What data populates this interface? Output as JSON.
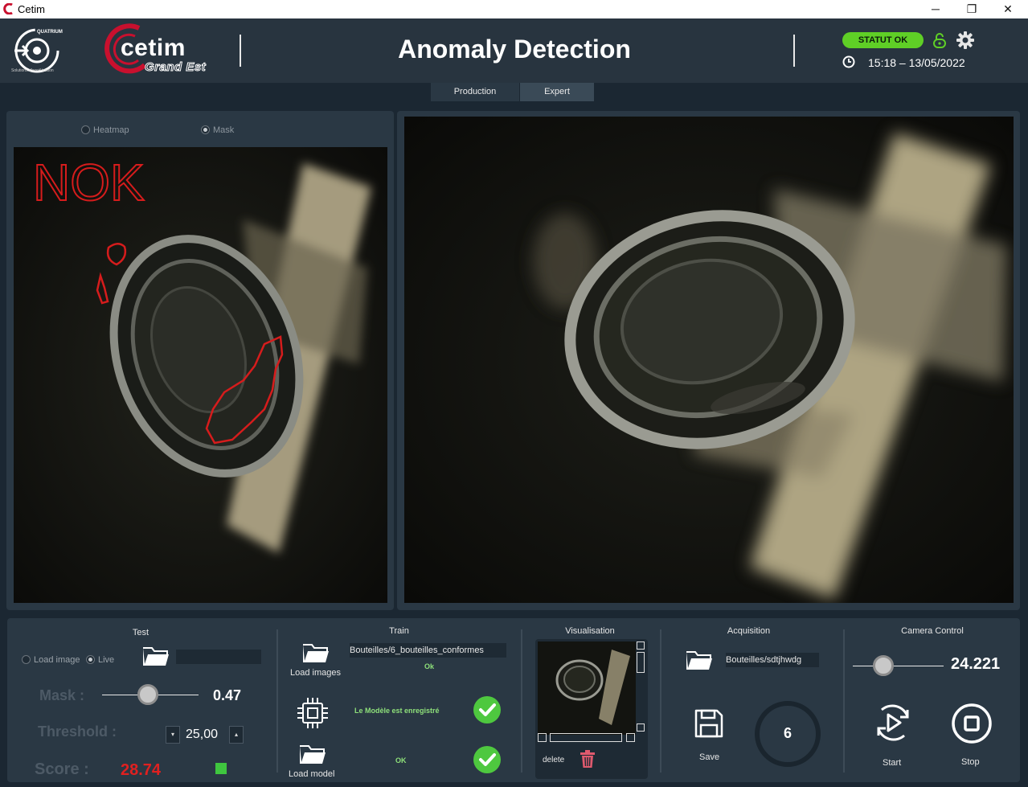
{
  "window": {
    "title": "Cetim",
    "minimize": "─",
    "maximize": "❐",
    "close": "✕"
  },
  "header": {
    "logo_left_text": "QUATRIUM",
    "logo_left_sub": "Solutions d'accélération",
    "logo_cetim": "cetim",
    "logo_grand_est": "Grand Est",
    "title": "Anomaly Detection",
    "status": "STATUT OK",
    "datetime": "15:18 – 13/05/2022"
  },
  "tabs": [
    {
      "label": "Production"
    },
    {
      "label": "Expert"
    }
  ],
  "left_panel": {
    "heatmap_label": "Heatmap",
    "mask_label": "Mask",
    "selected": "Mask",
    "result_text": "NOK"
  },
  "test": {
    "title": "Test",
    "load_image_label": "Load image",
    "live_label": "Live",
    "selected_source": "Live",
    "path": "",
    "mask_label": "Mask :",
    "mask_value": "0.47",
    "threshold_label": "Threshold :",
    "threshold_value": "25,00",
    "score_label": "Score :",
    "score_value": "28.74"
  },
  "train": {
    "title": "Train",
    "images_path": "Bouteilles/6_bouteilles_conformes",
    "images_status": "Ok",
    "load_images_label": "Load images",
    "model_status": "Le Modèle est enregistré",
    "load_model_status": "OK",
    "load_model_label": "Load model"
  },
  "visualisation": {
    "title": "Visualisation",
    "delete_label": "delete"
  },
  "acquisition": {
    "title": "Acquisition",
    "path": "Bouteilles/sdtjhwdg",
    "save_label": "Save",
    "count": "6"
  },
  "camera": {
    "title": "Camera Control",
    "value": "24.221",
    "start_label": "Start",
    "stop_label": "Stop"
  },
  "colors": {
    "status_green": "#5fcf26",
    "nok_red": "#d61c1c",
    "score_red": "#e02020",
    "check_green": "#4ec83f",
    "indicator_green": "#3fc63f",
    "brand_red": "#c8102e"
  }
}
